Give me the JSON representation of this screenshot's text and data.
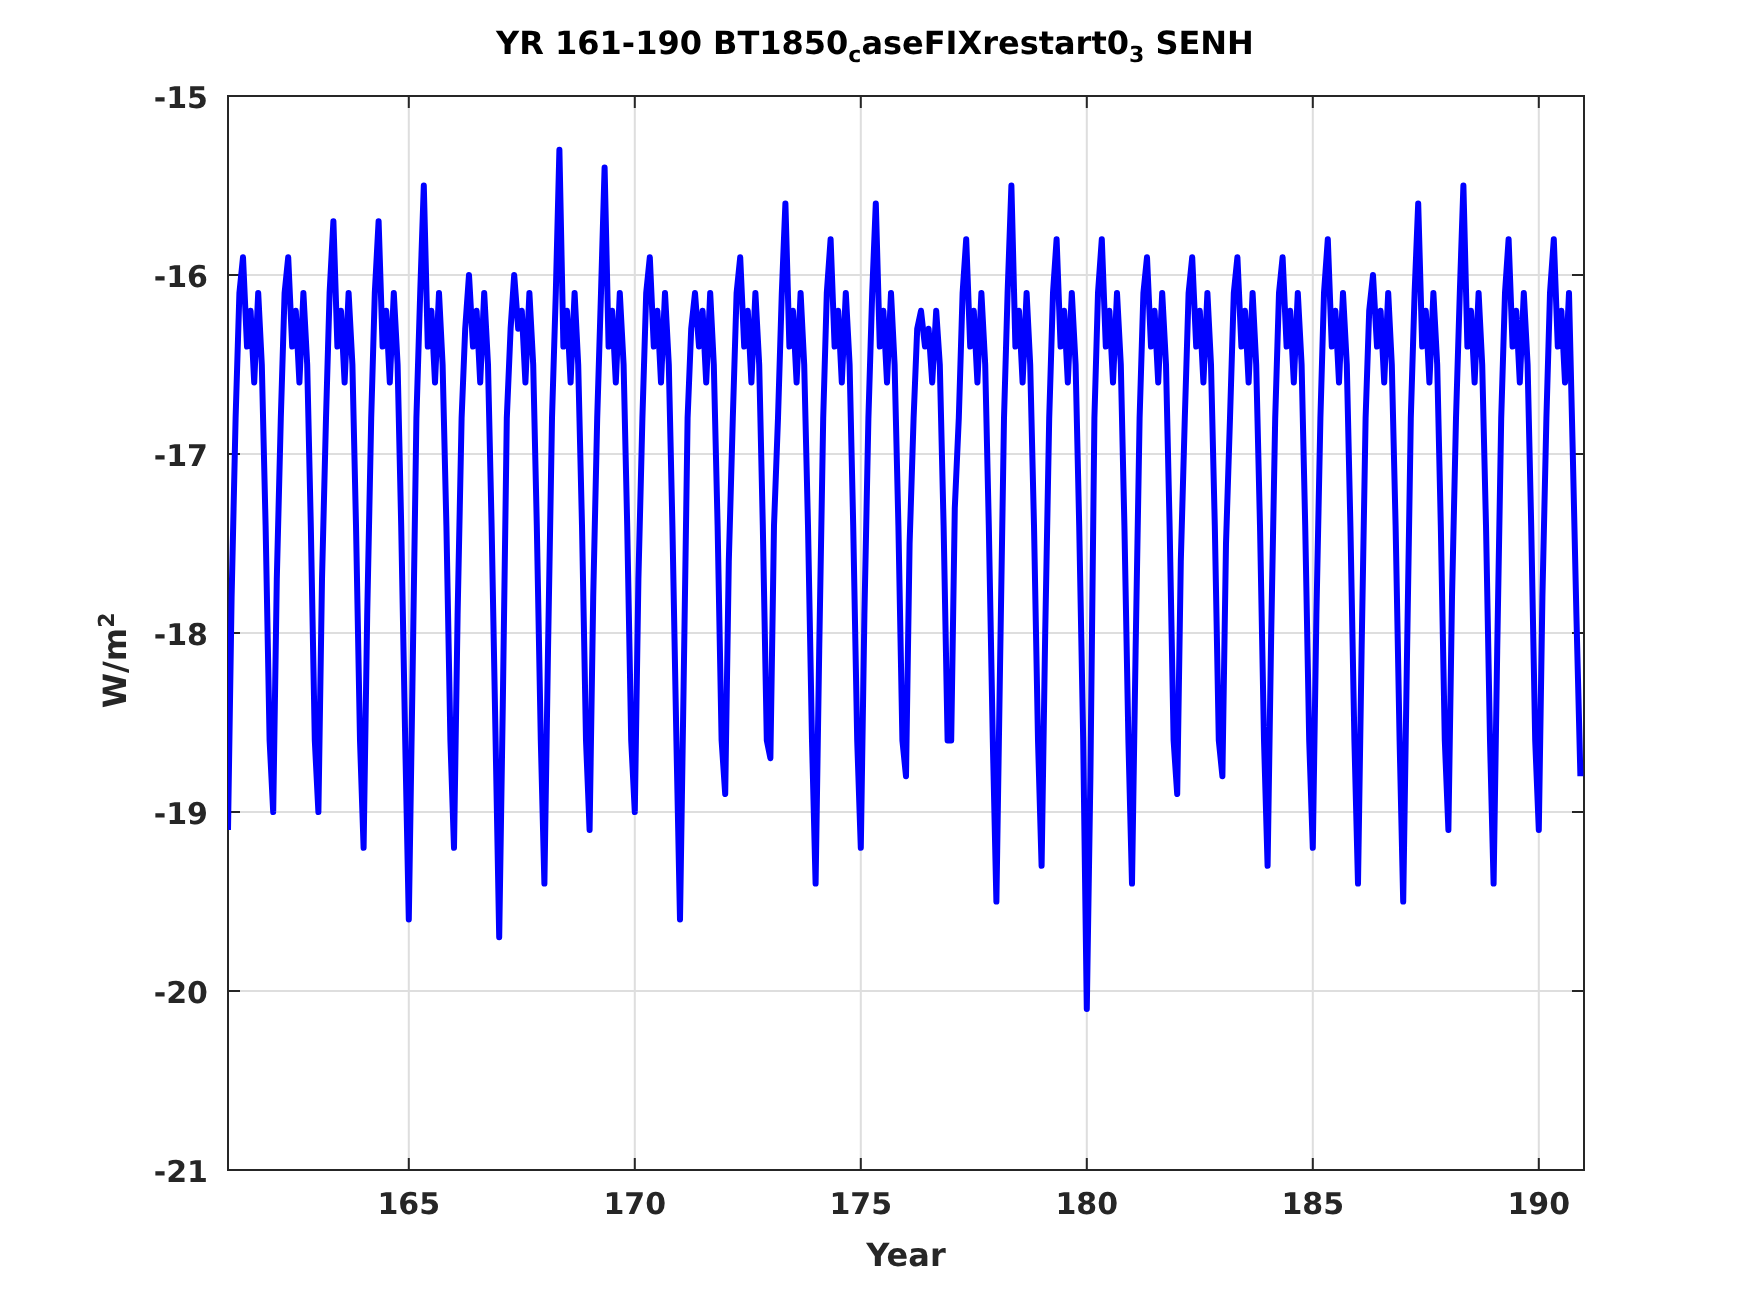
{
  "figure": {
    "chart_data": {
      "type": "line",
      "title": "YR 161-190 BT1850$_{c}$aseFIXrestart0$_{3}$ SENH",
      "xlabel": "Year",
      "ylabel": "W/m$^{2}$",
      "xlim": [
        161,
        191
      ],
      "ylim": [
        -21,
        -15
      ],
      "xticks": [
        165,
        170,
        175,
        180,
        185,
        190
      ],
      "yticks": [
        -21,
        -20,
        -19,
        -18,
        -17,
        -16,
        -15
      ],
      "grid": true,
      "x": [
        161,
        161.08,
        161.17,
        161.25,
        161.33,
        161.42,
        161.5,
        161.58,
        161.67,
        161.75,
        161.83,
        161.92,
        162,
        162.08,
        162.17,
        162.25,
        162.33,
        162.42,
        162.5,
        162.58,
        162.67,
        162.75,
        162.83,
        162.92,
        163,
        163.08,
        163.17,
        163.25,
        163.33,
        163.42,
        163.5,
        163.58,
        163.67,
        163.75,
        163.83,
        163.92,
        164,
        164.08,
        164.17,
        164.25,
        164.33,
        164.42,
        164.5,
        164.58,
        164.67,
        164.75,
        164.83,
        164.92,
        165,
        165.08,
        165.17,
        165.25,
        165.33,
        165.42,
        165.5,
        165.58,
        165.67,
        165.75,
        165.83,
        165.92,
        166,
        166.08,
        166.17,
        166.25,
        166.33,
        166.42,
        166.5,
        166.58,
        166.67,
        166.75,
        166.83,
        166.92,
        167,
        167.08,
        167.17,
        167.25,
        167.33,
        167.42,
        167.5,
        167.58,
        167.67,
        167.75,
        167.83,
        167.92,
        168,
        168.08,
        168.17,
        168.25,
        168.33,
        168.42,
        168.5,
        168.58,
        168.67,
        168.75,
        168.83,
        168.92,
        169,
        169.08,
        169.17,
        169.25,
        169.33,
        169.42,
        169.5,
        169.58,
        169.67,
        169.75,
        169.83,
        169.92,
        170,
        170.08,
        170.17,
        170.25,
        170.33,
        170.42,
        170.5,
        170.58,
        170.67,
        170.75,
        170.83,
        170.92,
        171,
        171.08,
        171.17,
        171.25,
        171.33,
        171.42,
        171.5,
        171.58,
        171.67,
        171.75,
        171.83,
        171.92,
        172,
        172.08,
        172.17,
        172.25,
        172.33,
        172.42,
        172.5,
        172.58,
        172.67,
        172.75,
        172.83,
        172.92,
        173,
        173.08,
        173.17,
        173.25,
        173.33,
        173.42,
        173.5,
        173.58,
        173.67,
        173.75,
        173.83,
        173.92,
        174,
        174.08,
        174.17,
        174.25,
        174.33,
        174.42,
        174.5,
        174.58,
        174.67,
        174.75,
        174.83,
        174.92,
        175,
        175.08,
        175.17,
        175.25,
        175.33,
        175.42,
        175.5,
        175.58,
        175.67,
        175.75,
        175.83,
        175.92,
        176,
        176.08,
        176.17,
        176.25,
        176.33,
        176.42,
        176.5,
        176.58,
        176.67,
        176.75,
        176.83,
        176.92,
        177,
        177.08,
        177.17,
        177.25,
        177.33,
        177.42,
        177.5,
        177.58,
        177.67,
        177.75,
        177.83,
        177.92,
        178,
        178.08,
        178.17,
        178.25,
        178.33,
        178.42,
        178.5,
        178.58,
        178.67,
        178.75,
        178.83,
        178.92,
        179,
        179.08,
        179.17,
        179.25,
        179.33,
        179.42,
        179.5,
        179.58,
        179.67,
        179.75,
        179.83,
        179.92,
        180,
        180.08,
        180.17,
        180.25,
        180.33,
        180.42,
        180.5,
        180.58,
        180.67,
        180.75,
        180.83,
        180.92,
        181,
        181.08,
        181.17,
        181.25,
        181.33,
        181.42,
        181.5,
        181.58,
        181.67,
        181.75,
        181.83,
        181.92,
        182,
        182.08,
        182.17,
        182.25,
        182.33,
        182.42,
        182.5,
        182.58,
        182.67,
        182.75,
        182.83,
        182.92,
        183,
        183.08,
        183.17,
        183.25,
        183.33,
        183.42,
        183.5,
        183.58,
        183.67,
        183.75,
        183.83,
        183.92,
        184,
        184.08,
        184.17,
        184.25,
        184.33,
        184.42,
        184.5,
        184.58,
        184.67,
        184.75,
        184.83,
        184.92,
        185,
        185.08,
        185.17,
        185.25,
        185.33,
        185.42,
        185.5,
        185.58,
        185.67,
        185.75,
        185.83,
        185.92,
        186,
        186.08,
        186.17,
        186.25,
        186.33,
        186.42,
        186.5,
        186.58,
        186.67,
        186.75,
        186.83,
        186.92,
        187,
        187.08,
        187.17,
        187.25,
        187.33,
        187.42,
        187.5,
        187.58,
        187.67,
        187.75,
        187.83,
        187.92,
        188,
        188.08,
        188.17,
        188.25,
        188.33,
        188.42,
        188.5,
        188.58,
        188.67,
        188.75,
        188.83,
        188.92,
        189,
        189.08,
        189.17,
        189.25,
        189.33,
        189.42,
        189.5,
        189.58,
        189.67,
        189.75,
        189.83,
        189.92,
        190,
        190.08,
        190.17,
        190.25,
        190.33,
        190.42,
        190.5,
        190.58,
        190.67,
        190.75,
        190.83,
        190.92
      ],
      "series": [
        {
          "color": "#0000ff",
          "values": [
            -19.1,
            -17.8,
            -16.8,
            -16.1,
            -15.9,
            -16.4,
            -16.2,
            -16.6,
            -16.1,
            -16.5,
            -17.4,
            -18.6,
            -19.0,
            -17.7,
            -16.8,
            -16.1,
            -15.9,
            -16.4,
            -16.2,
            -16.6,
            -16.1,
            -16.5,
            -17.4,
            -18.6,
            -19.0,
            -17.7,
            -16.8,
            -16.1,
            -15.7,
            -16.4,
            -16.2,
            -16.6,
            -16.1,
            -16.5,
            -17.4,
            -18.6,
            -19.2,
            -17.9,
            -16.8,
            -16.1,
            -15.7,
            -16.4,
            -16.2,
            -16.6,
            -16.1,
            -16.5,
            -17.4,
            -18.6,
            -19.6,
            -18.3,
            -16.8,
            -16.1,
            -15.5,
            -16.4,
            -16.2,
            -16.6,
            -16.1,
            -16.5,
            -17.4,
            -18.6,
            -19.2,
            -17.9,
            -16.8,
            -16.3,
            -16.0,
            -16.4,
            -16.2,
            -16.6,
            -16.1,
            -16.5,
            -17.4,
            -18.6,
            -19.7,
            -18.4,
            -16.8,
            -16.3,
            -16.0,
            -16.3,
            -16.2,
            -16.6,
            -16.1,
            -16.5,
            -17.4,
            -18.6,
            -19.4,
            -18.1,
            -16.8,
            -16.1,
            -15.3,
            -16.4,
            -16.2,
            -16.6,
            -16.1,
            -16.5,
            -17.4,
            -18.6,
            -19.1,
            -17.8,
            -16.8,
            -16.1,
            -15.4,
            -16.4,
            -16.2,
            -16.6,
            -16.1,
            -16.5,
            -17.4,
            -18.6,
            -19.0,
            -17.7,
            -16.8,
            -16.1,
            -15.9,
            -16.4,
            -16.2,
            -16.6,
            -16.1,
            -16.5,
            -17.4,
            -18.6,
            -19.6,
            -18.3,
            -16.8,
            -16.3,
            -16.1,
            -16.4,
            -16.2,
            -16.6,
            -16.1,
            -16.5,
            -17.4,
            -18.6,
            -18.9,
            -17.6,
            -16.8,
            -16.1,
            -15.9,
            -16.4,
            -16.2,
            -16.6,
            -16.1,
            -16.5,
            -17.4,
            -18.6,
            -18.7,
            -17.4,
            -16.8,
            -16.1,
            -15.6,
            -16.4,
            -16.2,
            -16.6,
            -16.1,
            -16.5,
            -17.4,
            -18.6,
            -19.4,
            -18.1,
            -16.8,
            -16.1,
            -15.8,
            -16.4,
            -16.2,
            -16.6,
            -16.1,
            -16.5,
            -17.4,
            -18.6,
            -19.2,
            -17.9,
            -16.8,
            -16.1,
            -15.6,
            -16.4,
            -16.2,
            -16.6,
            -16.1,
            -16.5,
            -17.4,
            -18.6,
            -18.8,
            -17.5,
            -16.8,
            -16.3,
            -16.2,
            -16.4,
            -16.3,
            -16.6,
            -16.2,
            -16.5,
            -17.4,
            -18.6,
            -18.6,
            -17.3,
            -16.8,
            -16.1,
            -15.8,
            -16.4,
            -16.2,
            -16.6,
            -16.1,
            -16.5,
            -17.4,
            -18.6,
            -19.5,
            -18.2,
            -16.8,
            -16.1,
            -15.5,
            -16.4,
            -16.2,
            -16.6,
            -16.1,
            -16.5,
            -17.4,
            -18.6,
            -19.3,
            -18.0,
            -16.8,
            -16.1,
            -15.8,
            -16.4,
            -16.2,
            -16.6,
            -16.1,
            -16.5,
            -17.4,
            -18.6,
            -20.1,
            -18.8,
            -16.8,
            -16.1,
            -15.8,
            -16.4,
            -16.2,
            -16.6,
            -16.1,
            -16.5,
            -17.4,
            -18.6,
            -19.4,
            -18.1,
            -16.8,
            -16.1,
            -15.9,
            -16.4,
            -16.2,
            -16.6,
            -16.1,
            -16.5,
            -17.4,
            -18.6,
            -18.9,
            -17.6,
            -16.8,
            -16.1,
            -15.9,
            -16.4,
            -16.2,
            -16.6,
            -16.1,
            -16.5,
            -17.4,
            -18.6,
            -18.8,
            -17.5,
            -16.8,
            -16.1,
            -15.9,
            -16.4,
            -16.2,
            -16.6,
            -16.1,
            -16.5,
            -17.4,
            -18.6,
            -19.3,
            -18.0,
            -16.8,
            -16.1,
            -15.9,
            -16.4,
            -16.2,
            -16.6,
            -16.1,
            -16.5,
            -17.4,
            -18.6,
            -19.2,
            -17.9,
            -16.8,
            -16.1,
            -15.8,
            -16.4,
            -16.2,
            -16.6,
            -16.1,
            -16.5,
            -17.4,
            -18.6,
            -19.4,
            -18.1,
            -16.8,
            -16.2,
            -16.0,
            -16.4,
            -16.2,
            -16.6,
            -16.1,
            -16.5,
            -17.4,
            -18.6,
            -19.5,
            -18.2,
            -16.8,
            -16.1,
            -15.6,
            -16.4,
            -16.2,
            -16.6,
            -16.1,
            -16.5,
            -17.4,
            -18.6,
            -19.1,
            -17.8,
            -16.8,
            -16.1,
            -15.5,
            -16.4,
            -16.2,
            -16.6,
            -16.1,
            -16.5,
            -17.4,
            -18.6,
            -19.4,
            -18.1,
            -16.8,
            -16.1,
            -15.8,
            -16.4,
            -16.2,
            -16.6,
            -16.1,
            -16.5,
            -17.4,
            -18.6,
            -19.1,
            -17.8,
            -16.8,
            -16.1,
            -15.8,
            -16.4,
            -16.2,
            -16.6,
            -16.1,
            -17.0,
            -17.9,
            -18.8
          ]
        }
      ]
    }
  }
}
